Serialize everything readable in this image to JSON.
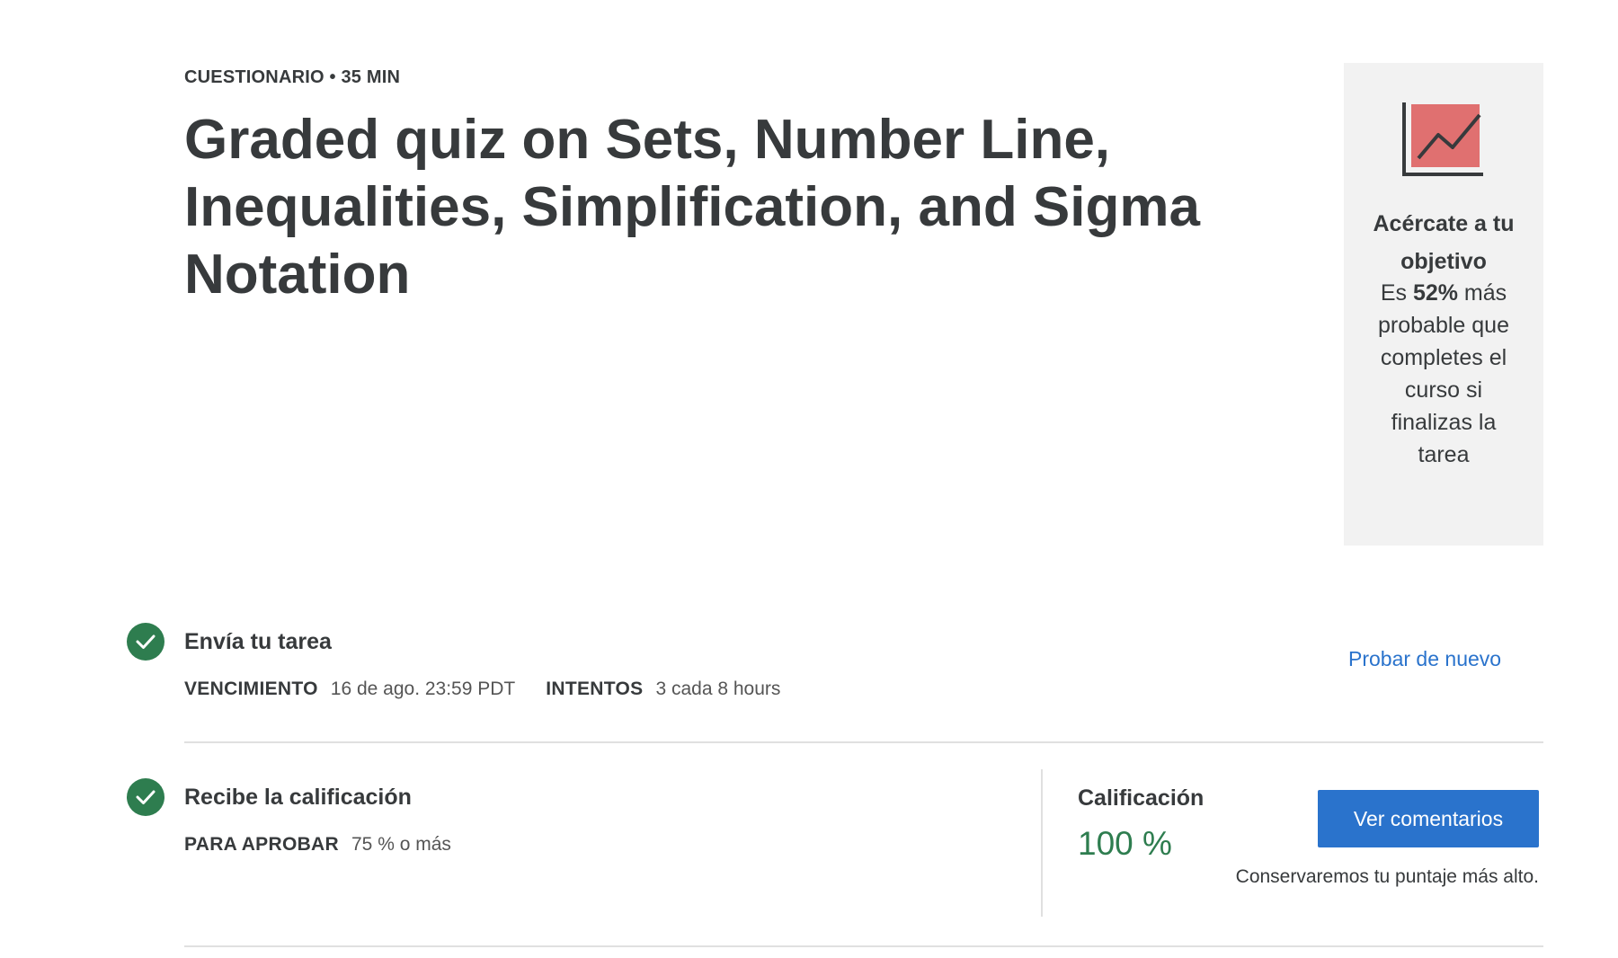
{
  "header": {
    "eyebrow": "CUESTIONARIO • 35 MIN",
    "title": "Graded quiz on Sets, Number Line, Inequalities, Simplification, and Sigma Notation"
  },
  "goal_card": {
    "icon": "trend-chart-icon",
    "heading": "Acércate a tu objetivo",
    "body_prefix": "Es ",
    "body_highlight": "52%",
    "body_suffix": " más probable que completes el curso si finalizas la tarea"
  },
  "submit_step": {
    "title": "Envía tu tarea",
    "due_label": "VENCIMIENTO",
    "due_value": "16 de ago. 23:59 PDT",
    "attempts_label": "INTENTOS",
    "attempts_value": "3 cada 8 hours",
    "retry_link": "Probar de nuevo",
    "status_icon": "check-circle-icon"
  },
  "grade_step": {
    "title": "Recibe la calificación",
    "pass_label": "PARA APROBAR",
    "pass_value": "75 % o más",
    "status_icon": "check-circle-icon"
  },
  "grade": {
    "label": "Calificación",
    "value": "100 %",
    "button_label": "Ver comentarios",
    "note": "Conservaremos tu puntaje más alto."
  },
  "colors": {
    "accent_blue": "#2a73cc",
    "success_green": "#2e7d4f",
    "icon_red": "#e07070",
    "card_bg": "#f2f2f2"
  }
}
